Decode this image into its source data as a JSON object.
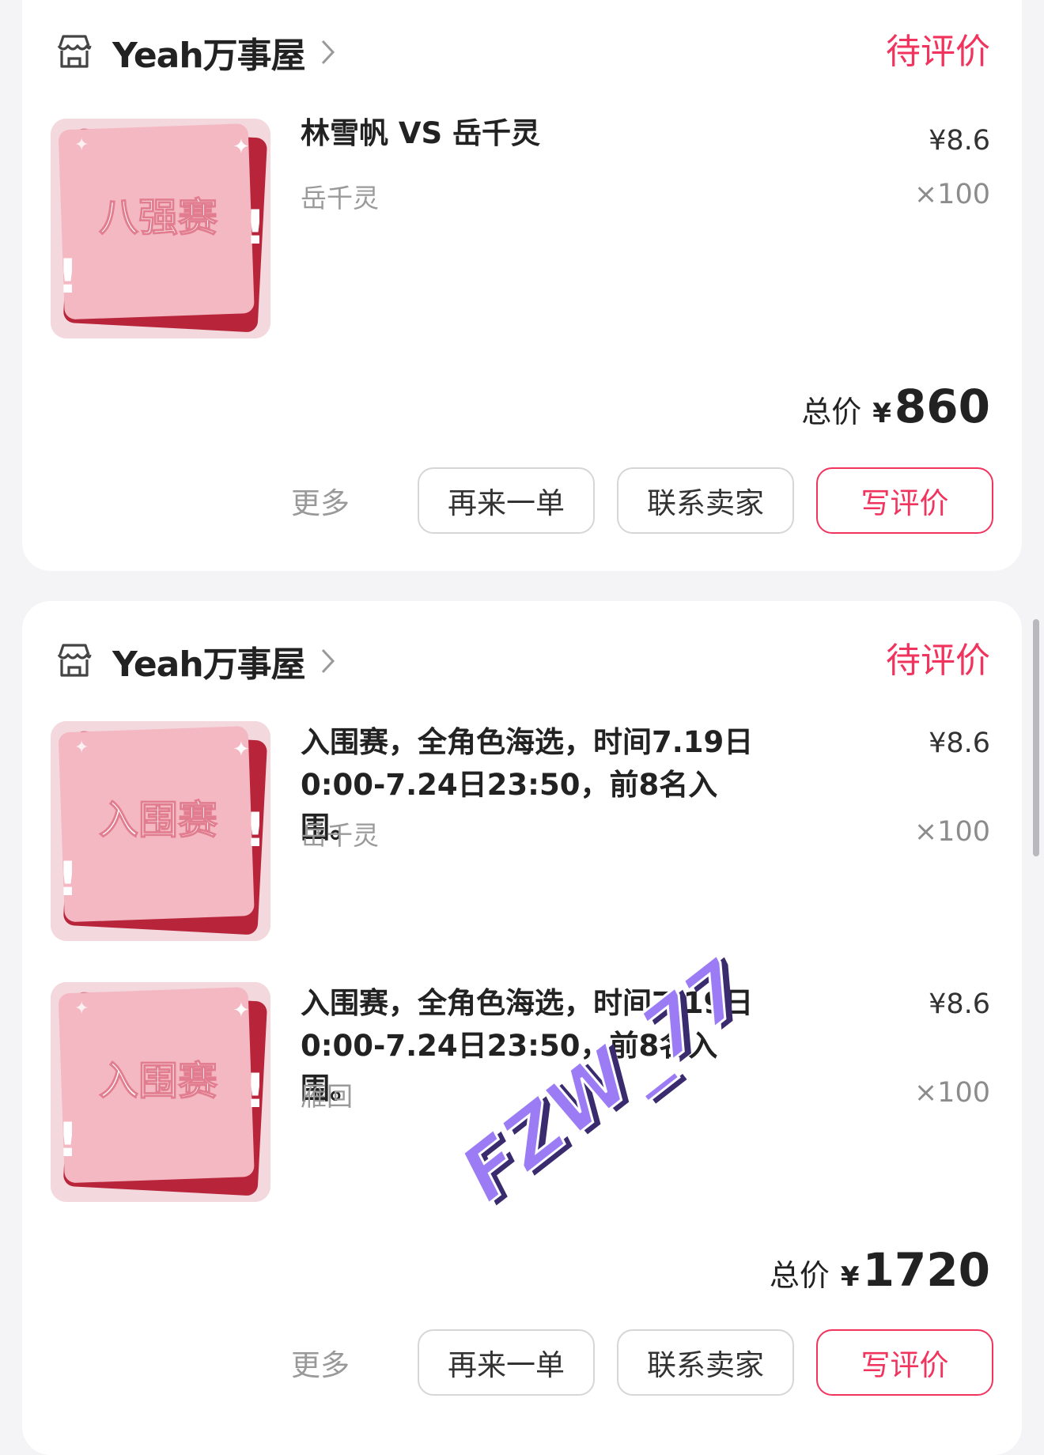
{
  "orders": [
    {
      "shop_name": "Yeah万事屋",
      "status": "待评价",
      "items": [
        {
          "thumb_text": "八强赛",
          "title": "林雪帆 VS 岳千灵",
          "spec": "岳千灵",
          "price": "¥8.6",
          "qty": "×100"
        }
      ],
      "total_label": "总价",
      "total_currency": "¥",
      "total_amount": "860",
      "more_label": "更多",
      "buttons": {
        "reorder": "再来一单",
        "contact": "联系卖家",
        "review": "写评价"
      }
    },
    {
      "shop_name": "Yeah万事屋",
      "status": "待评价",
      "items": [
        {
          "thumb_text": "入围赛",
          "title": "入围赛，全角色海选，时间7.19日0:00-7.24日23:50，前8名入围。",
          "spec": "岳千灵",
          "price": "¥8.6",
          "qty": "×100"
        },
        {
          "thumb_text": "入围赛",
          "title": "入围赛，全角色海选，时间7.19日0:00-7.24日23:50，前8名入围。",
          "spec": "雁回",
          "price": "¥8.6",
          "qty": "×100"
        }
      ],
      "total_label": "总价",
      "total_currency": "¥",
      "total_amount": "1720",
      "more_label": "更多",
      "buttons": {
        "reorder": "再来一单",
        "contact": "联系卖家",
        "review": "写评价"
      }
    }
  ],
  "watermark": "FZW_77",
  "colors": {
    "accent": "#f0345e",
    "thumb_bg": "#f4b8c3",
    "thumb_dark": "#b8253a",
    "watermark": "#9b7cf5"
  },
  "icons": {
    "shop": "shop-icon",
    "chevron": "chevron-right-icon"
  }
}
